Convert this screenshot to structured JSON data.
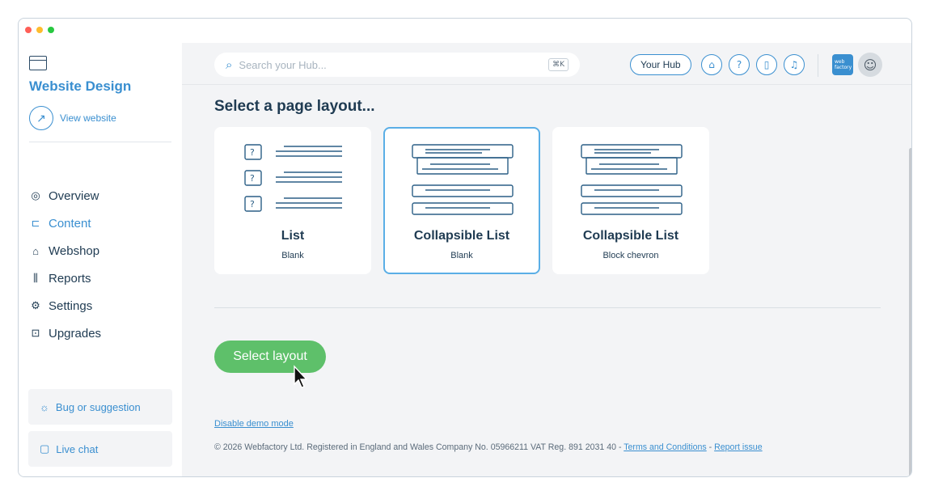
{
  "window": {
    "dot_colors": [
      "#ff5f57",
      "#febc2e",
      "#28c840"
    ]
  },
  "sidebar": {
    "site_title": "Website Design",
    "view_website_label": "View website",
    "items": [
      {
        "label": "Overview",
        "icon": "compass-icon",
        "glyph": "◎"
      },
      {
        "label": "Content",
        "icon": "sitemap-icon",
        "glyph": "⊏",
        "active": true
      },
      {
        "label": "Webshop",
        "icon": "basket-icon",
        "glyph": "⌂"
      },
      {
        "label": "Reports",
        "icon": "chart-icon",
        "glyph": "⫼"
      },
      {
        "label": "Settings",
        "icon": "gear-icon",
        "glyph": "⚙"
      },
      {
        "label": "Upgrades",
        "icon": "upgrade-icon",
        "glyph": "⊡"
      }
    ],
    "bug_label": "Bug or suggestion",
    "chat_label": "Live chat"
  },
  "header": {
    "search_placeholder": "Search your Hub...",
    "shortcut": "⌘K",
    "hub_label": "Your Hub",
    "logo_text": "web factory"
  },
  "main": {
    "title": "Select a page layout...",
    "cards": [
      {
        "title": "List",
        "subtitle": "Blank",
        "selected": false
      },
      {
        "title": "Collapsible List",
        "subtitle": "Blank",
        "selected": true
      },
      {
        "title": "Collapsible List",
        "subtitle": "Block chevron",
        "selected": false
      }
    ],
    "select_button": "Select layout",
    "demo_link": "Disable demo mode",
    "footer_text": "© 2026 Webfactory Ltd. Registered in England and Wales Company No. 05966211 VAT Reg. 891 2031 40 - ",
    "terms_label": "Terms and Conditions",
    "footer_sep": " - ",
    "report_label": "Report issue"
  },
  "colors": {
    "accent": "#3a8fd0",
    "primary_button": "#5ec06a",
    "selected_border": "#5aaee6"
  }
}
